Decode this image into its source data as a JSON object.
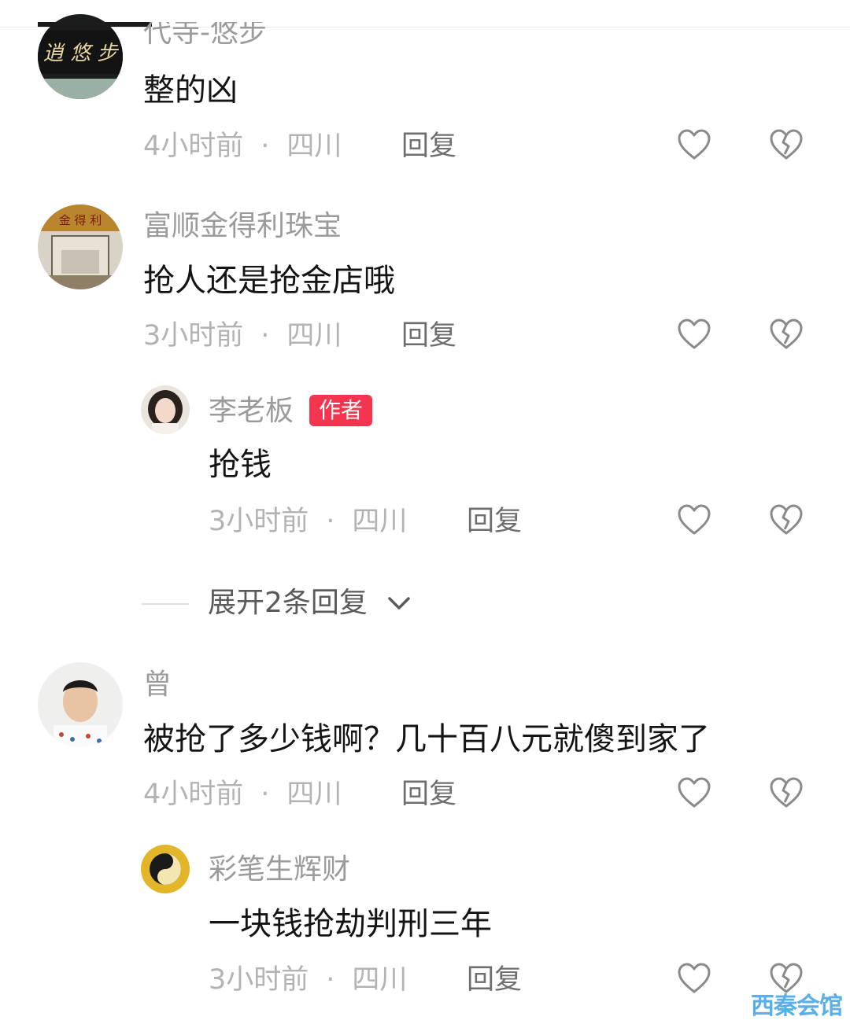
{
  "comments": [
    {
      "username": "代寺-悠步",
      "text": "整的凶",
      "time": "4小时前",
      "location": "四川",
      "reply_label": "回复",
      "avatar_sign": "逍 悠 步"
    },
    {
      "username": "富顺金得利珠宝",
      "text": "抢人还是抢金店哦",
      "time": "3小时前",
      "location": "四川",
      "reply_label": "回复",
      "avatar_sign": "金 得 利"
    },
    {
      "username": "李老板",
      "badge": "作者",
      "text": "抢钱",
      "time": "3小时前",
      "location": "四川",
      "reply_label": "回复"
    },
    {
      "username": "曾",
      "text": "被抢了多少钱啊？几十百八元就傻到家了",
      "time": "4小时前",
      "location": "四川",
      "reply_label": "回复"
    },
    {
      "username": "彩笔生辉财",
      "text": "一块钱抢劫判刑三年",
      "time": "3小时前",
      "location": "四川",
      "reply_label": "回复"
    }
  ],
  "expand": {
    "label": "展开2条回复"
  },
  "separator": "·",
  "watermark": "西秦会馆",
  "icons": {
    "like": "heart-outline-icon",
    "dislike": "broken-heart-icon",
    "expand": "chevron-down-icon"
  },
  "colors": {
    "badge": "#f5344f",
    "meta": "#b3b3b3",
    "username": "#9b9b9b",
    "watermark": "#4aa7e6"
  }
}
